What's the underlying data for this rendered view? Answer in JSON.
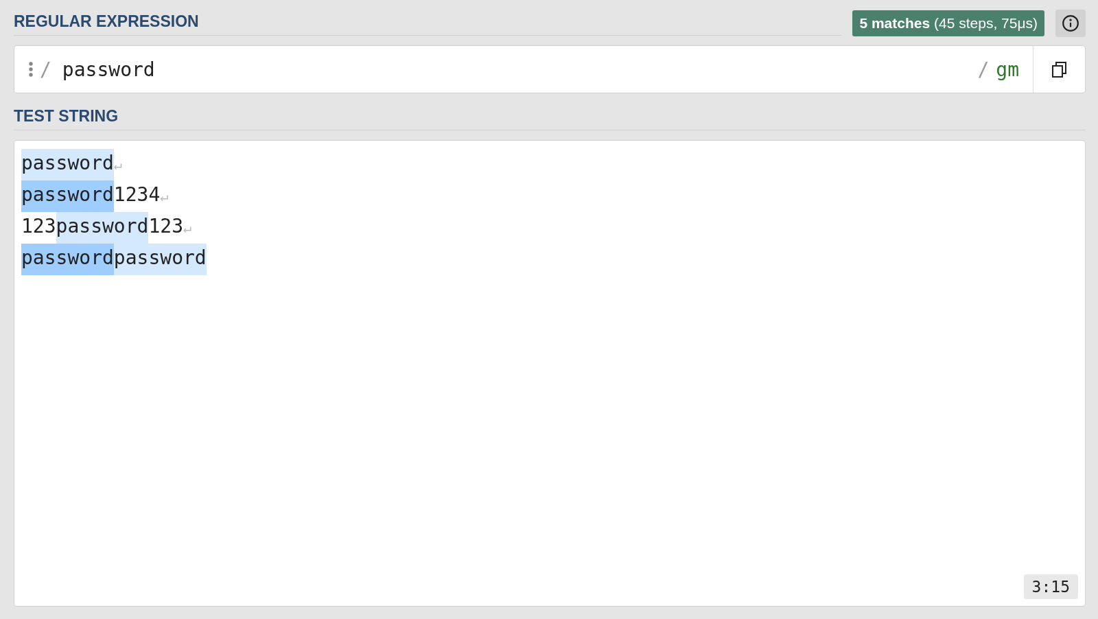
{
  "regex_section": {
    "title": "REGULAR EXPRESSION",
    "match_badge": {
      "count": "5 matches",
      "details": "(45 steps, 75μs)"
    },
    "delimiter_open": "/",
    "pattern": "password",
    "delimiter_close": "/",
    "flags": "gm"
  },
  "test_section": {
    "title": "TEST STRING",
    "lines": [
      {
        "segments": [
          {
            "text": "password",
            "color": "#d5e9fe"
          }
        ],
        "eol": "↵"
      },
      {
        "segments": [
          {
            "text": "password",
            "color": "#9fcdfd"
          },
          {
            "text": "1234"
          }
        ],
        "eol": "↵"
      },
      {
        "segments": [
          {
            "text": "123"
          },
          {
            "text": "password",
            "color": "#d5e9fe"
          },
          {
            "text": "123"
          }
        ],
        "eol": "↵"
      },
      {
        "segments": [
          {
            "text": "password",
            "color": "#9fcdfd"
          },
          {
            "text": "password",
            "color": "#d5e9fe"
          }
        ]
      }
    ],
    "cursor_position": "3:15"
  }
}
